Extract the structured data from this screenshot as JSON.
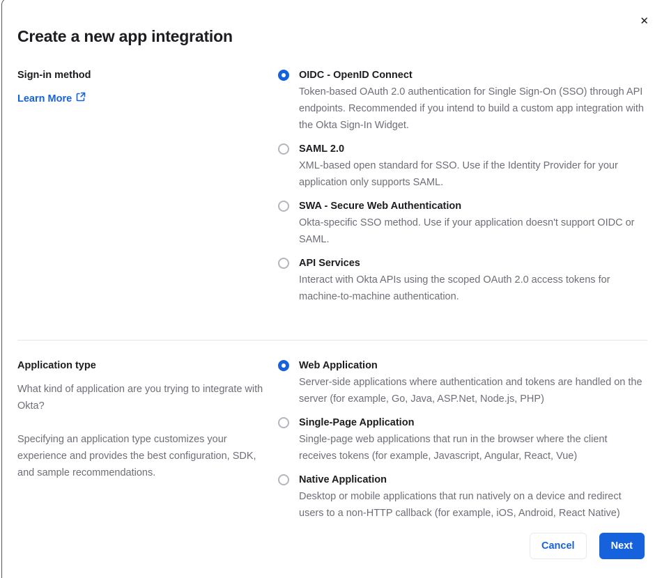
{
  "modal": {
    "title": "Create a new app integration",
    "close_glyph": "✕"
  },
  "colors": {
    "accent_blue": "#1662dd",
    "text_dark": "#1d1d21",
    "text_gray": "#6e6e78",
    "divider": "#e5e5e8",
    "modal_border": "#54545e",
    "radio_unselected_border": "#b5b5bd"
  },
  "signin": {
    "label": "Sign-in method",
    "learn_more_label": "Learn More",
    "options": [
      {
        "title": "OIDC - OpenID Connect",
        "desc": "Token-based OAuth 2.0 authentication for Single Sign-On (SSO) through API endpoints. Recommended if you intend to build a custom app integration with the Okta Sign-In Widget.",
        "selected": true
      },
      {
        "title": "SAML 2.0",
        "desc": "XML-based open standard for SSO. Use if the Identity Provider for your application only supports SAML.",
        "selected": false
      },
      {
        "title": "SWA - Secure Web Authentication",
        "desc": "Okta-specific SSO method. Use if your application doesn't support OIDC or SAML.",
        "selected": false
      },
      {
        "title": "API Services",
        "desc": "Interact with Okta APIs using the scoped OAuth 2.0 access tokens for machine-to-machine authentication.",
        "selected": false
      }
    ]
  },
  "apptype": {
    "label": "Application type",
    "para1": "What kind of application are you trying to integrate with Okta?",
    "para2": "Specifying an application type customizes your experience and provides the best configuration, SDK, and sample recommendations.",
    "options": [
      {
        "title": "Web Application",
        "desc": "Server-side applications where authentication and tokens are handled on the server (for example, Go, Java, ASP.Net, Node.js, PHP)",
        "selected": true
      },
      {
        "title": "Single-Page Application",
        "desc": "Single-page web applications that run in the browser where the client receives tokens (for example, Javascript, Angular, React, Vue)",
        "selected": false
      },
      {
        "title": "Native Application",
        "desc": "Desktop or mobile applications that run natively on a device and redirect users to a non-HTTP callback (for example, iOS, Android, React Native)",
        "selected": false
      }
    ]
  },
  "footer": {
    "cancel_label": "Cancel",
    "next_label": "Next"
  }
}
